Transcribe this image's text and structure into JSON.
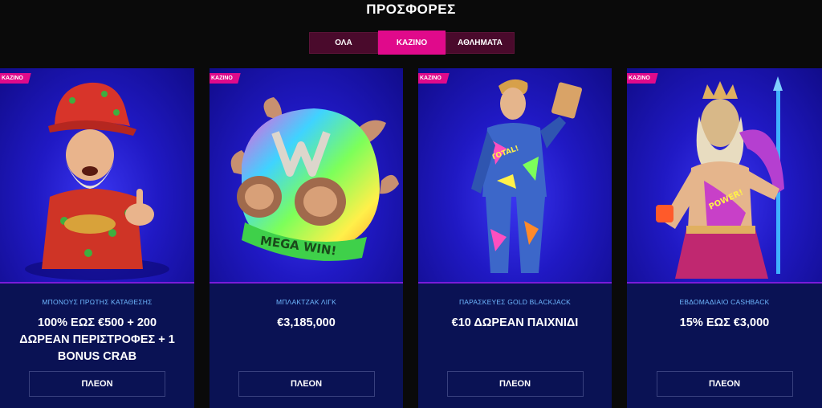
{
  "page": {
    "title": "ΠΡΟΣΦΟΡΕΣ"
  },
  "tabs": [
    {
      "label": "ΟΛΑ",
      "active": false
    },
    {
      "label": "ΚΑΖΙΝΟ",
      "active": true
    },
    {
      "label": "ΑΘΛΗΜΑΤΑ",
      "active": false
    }
  ],
  "colors": {
    "accent": "#e00a8b",
    "card_bg": "#0a1254",
    "subtitle": "#6fb8ff"
  },
  "cards": [
    {
      "tag": "ΚΑΖΙΝΟ",
      "subtitle": "ΜΠΟΝΟΥΣ ΠΡΩΤΗΣ ΚΑΤΑΘΕΣΗΣ",
      "title": "100% ΕΩΣ €500 + 200 ΔΩΡΕΑΝ ΠΕΡΙΣΤΡΟΦΕΣ + 1 BONUS CRAB",
      "button": "ΠΛΕΟΝ",
      "image": "leprechaun-character"
    },
    {
      "tag": "ΚΑΖΙΝΟ",
      "subtitle": "ΜΠΛΑΚΤΖΑΚ ΛΙΓΚ",
      "title": "€3,185,000",
      "button": "ΠΛΕΟΝ",
      "image": "mega-win-helmet",
      "image_text": "MEGA WIN!"
    },
    {
      "tag": "ΚΑΖΙΝΟ",
      "subtitle": "ΠΑΡΑΣΚΕΥΕΣ GOLD BLACKJACK",
      "title": "€10 ΔΩΡΕΑΝ ΠΑΙΧΝΙΔΙ",
      "button": "ΠΛΕΟΝ",
      "image": "suited-man-character",
      "image_text": "TOTAL!"
    },
    {
      "tag": "ΚΑΖΙΝΟ",
      "subtitle": "ΕΒΔΟΜΑΔΙΑΙΟ CASHBACK",
      "title": "15% ΕΩΣ €3,000",
      "button": "ΠΛΕΟΝ",
      "image": "zeus-character",
      "image_text": "POWER!"
    }
  ]
}
